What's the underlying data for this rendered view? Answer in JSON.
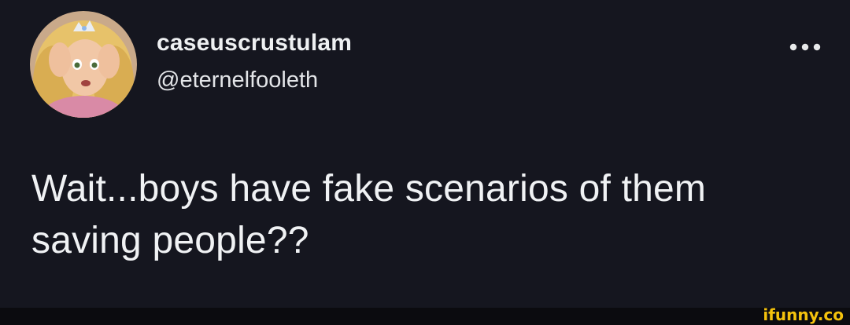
{
  "tweet": {
    "display_name": "caseuscrustulam",
    "handle": "@eternelfooleth",
    "more_icon": "more-horizontal-icon",
    "text_lines": [
      "Wait...boys have fake scenarios of them",
      "saving people??"
    ]
  },
  "watermark": "ifunny.co",
  "colors": {
    "background": "#15161f",
    "text": "#e7e9ea",
    "watermark": "#f4c20d"
  }
}
